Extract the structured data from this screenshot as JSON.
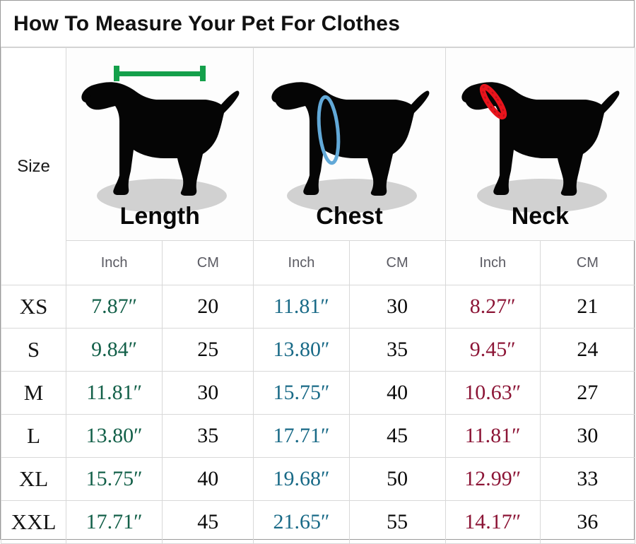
{
  "title": "How To Measure Your Pet For Clothes",
  "size_column_header": "Size",
  "diagrams": [
    {
      "name": "length",
      "label": "Length",
      "marker_type": "straight-bar-with-end-caps",
      "marker_color": "#14a04b",
      "marker_description": "green horizontal measurement bar along the back"
    },
    {
      "name": "chest",
      "label": "Chest",
      "marker_type": "vertical-loop",
      "marker_color": "#62a9d8",
      "marker_description": "light blue girth loop around the chest behind the front legs"
    },
    {
      "name": "neck",
      "label": "Neck",
      "marker_type": "collar-ring",
      "marker_color": "#e8141c",
      "marker_description": "red beaded collar around the neck"
    }
  ],
  "unit_headers": [
    "Inch",
    "CM",
    "Inch",
    "CM",
    "Inch",
    "CM"
  ],
  "colors": {
    "length_text": "#136049",
    "chest_text": "#196a87",
    "neck_text": "#8c1536",
    "cm_text": "#0b0b0b",
    "dog_silhouette": "#050505",
    "shadow": "#c9c9c9",
    "border": "#d8d8d8",
    "outer_border": "#9a9a9a"
  },
  "rows": [
    {
      "size": "XS",
      "length_inch": "7.87″",
      "length_cm": "20",
      "chest_inch": "11.81″",
      "chest_cm": "30",
      "neck_inch": "8.27″",
      "neck_cm": "21"
    },
    {
      "size": "S",
      "length_inch": "9.84″",
      "length_cm": "25",
      "chest_inch": "13.80″",
      "chest_cm": "35",
      "neck_inch": "9.45″",
      "neck_cm": "24"
    },
    {
      "size": "M",
      "length_inch": "11.81″",
      "length_cm": "30",
      "chest_inch": "15.75″",
      "chest_cm": "40",
      "neck_inch": "10.63″",
      "neck_cm": "27"
    },
    {
      "size": "L",
      "length_inch": "13.80″",
      "length_cm": "35",
      "chest_inch": "17.71″",
      "chest_cm": "45",
      "neck_inch": "11.81″",
      "neck_cm": "30"
    },
    {
      "size": "XL",
      "length_inch": "15.75″",
      "length_cm": "40",
      "chest_inch": "19.68″",
      "chest_cm": "50",
      "neck_inch": "12.99″",
      "neck_cm": "33"
    },
    {
      "size": "XXL",
      "length_inch": "17.71″",
      "length_cm": "45",
      "chest_inch": "21.65″",
      "chest_cm": "55",
      "neck_inch": "14.17″",
      "neck_cm": "36"
    }
  ]
}
